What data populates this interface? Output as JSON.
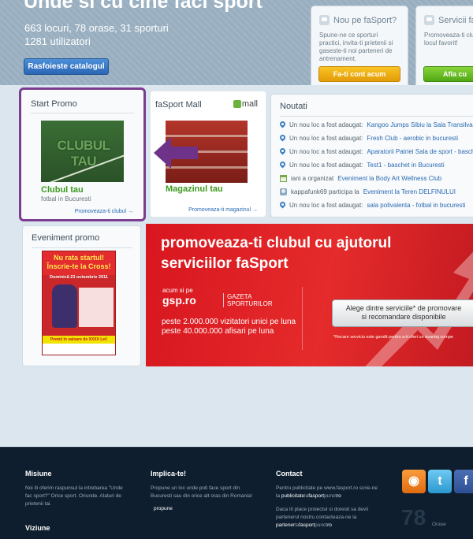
{
  "hero": {
    "title": "Unde si cu cine faci sport",
    "stats_line1": "663 locuri, 78 orase, 31 sporturi",
    "stats_line2": "1281 utilizatori",
    "catalog_button": "Rasfoieste catalogul"
  },
  "nou": {
    "title": "Nou pe faSport?",
    "text": "Spune-ne ce sporturi practici, invita-ti prietenii si gaseste-ti noi parteneri de antrenament.",
    "button": "Fa-ti cont acum",
    "button_color": "#f0b216"
  },
  "servicii": {
    "title": "Servicii fa",
    "text": "Promoveaza-ti clubul locul favorit!",
    "button": "Afla cu",
    "button_color": "#6cc027"
  },
  "promo": {
    "title": "Start Promo",
    "thumb_text": "CLUBUL TAU",
    "item_title": "Clubul tau",
    "item_sub": "fotbal in Bucuresti",
    "link": "Promoveaza-ti clubul →",
    "highlight_color": "#7b3c91"
  },
  "mall": {
    "title": "faSport Mall",
    "logo_text": "mall",
    "item_title": "Magazinul tau",
    "link": "Promoveaza-ti magazinul →"
  },
  "noutati": {
    "title": "Noutati",
    "items": [
      {
        "icon": "pin",
        "prefix": "Un nou loc a fost adaugat:",
        "link": "Kangoo Jumps Sibiu la Sala Transilvania"
      },
      {
        "icon": "pin",
        "prefix": "Un nou loc a fost adaugat:",
        "link": "Fresh Club - aerobic in bucuresti"
      },
      {
        "icon": "pin",
        "prefix": "Un nou loc a fost adaugat:",
        "link": "Aparatorii Patriei Sala de sport - baschet"
      },
      {
        "icon": "pin",
        "prefix": "Un nou loc a fost adaugat:",
        "link": "Test1 - baschet in Bucuresti"
      },
      {
        "icon": "calendar",
        "prefix": "iani a organizat",
        "link": "Eveniment la Body Art Wellness Club"
      },
      {
        "icon": "user",
        "prefix": "kappafunk69 participa la",
        "link": "Eveniment la Teren DELFINULUI"
      },
      {
        "icon": "pin",
        "prefix": "Un nou loc a fost adaugat:",
        "link": "sala polivalenta - fotbal in bucuresti"
      }
    ]
  },
  "event": {
    "title": "Eveniment promo",
    "poster_head1": "Nu rata startul!",
    "poster_head2": "Înscrie-te la Cross!",
    "poster_date": "Duminică 23 octombrie 2011",
    "poster_foot": "Premii în valoare de XXXX Lei!"
  },
  "banner": {
    "headline1": "promoveaza-ti clubul cu ajutorul",
    "headline2": "serviciilor faSport",
    "acum": "acum si pe",
    "gsp": "gsp.ro",
    "gsp_tag1": "GAZETA",
    "gsp_tag2": "SPORTURILOR",
    "stat1": "peste 2.000.000 vizitatori unici pe luna",
    "stat2": "peste 40.000.000 afisari pe luna",
    "cta1": "Alege dintre serviciile* de promovare",
    "cta2": "si recomandare disponibile",
    "note": "*Recare serviciu este gandit pentru a-ti oferi un avantaj compe"
  },
  "footer": {
    "misiune_title": "Misiune",
    "misiune_text": "Noi iti oferim raspunsul la intrebarea \"Unde fac sport?\" Orice sport. Oriunde. Alaturi de prietenii tai.",
    "viziune_title": "Viziune",
    "implica_title": "Implica-te!",
    "implica_text": "Propune un loc unde poti face sport din Bucuresti sau din orice alt oras din Romania!",
    "implica_pill": "propune",
    "contact_title": "Contact",
    "contact_text1a": "Pentru publicitate pe www.fasport.ro scrie-ne la ",
    "contact_text1b": "publicitate",
    "contact_text1c": "la",
    "contact_text1d": "fasport",
    "contact_text1e": "punct",
    "contact_text1f": "ro",
    "contact_text2a": "Daca iti place proiectul si doresti sa devii partenerul nostru contacteaza-ne la ",
    "contact_text2b": "partener",
    "contact_text2c": "la",
    "contact_text2d": "fasport",
    "contact_text2e": "punct",
    "contact_text2f": "ro",
    "count": "78",
    "count_label": "Orase"
  }
}
